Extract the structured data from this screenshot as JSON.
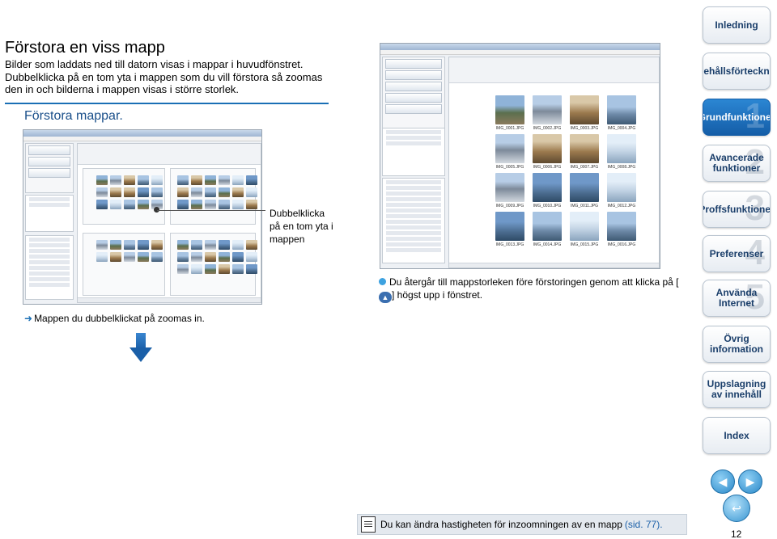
{
  "heading": {
    "title": "Förstora en viss mapp",
    "intro": "Bilder som laddats ned till datorn visas i mappar i huvudfönstret. Dubbelklicka på en tom yta i mappen som du vill förstora så zoomas den in och bilderna i mappen visas i större storlek.",
    "subhead": "Förstora mappar."
  },
  "callout": {
    "text": "Dubbelklicka på en tom yta i mappen"
  },
  "result_note": {
    "arrow": "➜",
    "text": "Mappen du dubbelklickat på zoomas in."
  },
  "tip": {
    "before": "Du återgår till mappstorleken före förstoringen genom att klicka på [",
    "after": "] högst upp i fönstret."
  },
  "screenshot_zoomed": {
    "thumbnails": [
      {
        "caption": "IMG_0001.JPG",
        "tone": "t1"
      },
      {
        "caption": "IMG_0002.JPG",
        "tone": "t2"
      },
      {
        "caption": "IMG_0003.JPG",
        "tone": "t3"
      },
      {
        "caption": "IMG_0004.JPG",
        "tone": "t4"
      },
      {
        "caption": "IMG_0005.JPG",
        "tone": "t2"
      },
      {
        "caption": "IMG_0006.JPG",
        "tone": "t3"
      },
      {
        "caption": "IMG_0007.JPG",
        "tone": "t3"
      },
      {
        "caption": "IMG_0008.JPG",
        "tone": "t5"
      },
      {
        "caption": "IMG_0009.JPG",
        "tone": "t2"
      },
      {
        "caption": "IMG_0010.JPG",
        "tone": "t6"
      },
      {
        "caption": "IMG_0011.JPG",
        "tone": "t6"
      },
      {
        "caption": "IMG_0012.JPG",
        "tone": "t5"
      },
      {
        "caption": "IMG_0013.JPG",
        "tone": "t6"
      },
      {
        "caption": "IMG_0014.JPG",
        "tone": "t4"
      },
      {
        "caption": "IMG_0015.JPG",
        "tone": "t5"
      },
      {
        "caption": "IMG_0016.JPG",
        "tone": "t4"
      }
    ]
  },
  "nav": {
    "items": [
      {
        "label": "Inledning",
        "num": "",
        "active": false
      },
      {
        "label": "Innehållsförteckning",
        "num": "",
        "active": false
      },
      {
        "label": "Grundfunktioner",
        "num": "1",
        "active": true
      },
      {
        "label": "Avancerade funktioner",
        "num": "2",
        "active": false
      },
      {
        "label": "Proffsfunktioner",
        "num": "3",
        "active": false
      },
      {
        "label": "Preferenser",
        "num": "4",
        "active": false
      },
      {
        "label": "Använda Internet",
        "num": "5",
        "active": false
      },
      {
        "label": "Övrig information",
        "num": "",
        "active": false
      },
      {
        "label": "Uppslagning av innehåll",
        "num": "",
        "active": false
      },
      {
        "label": "Index",
        "num": "",
        "active": false
      }
    ]
  },
  "footer": {
    "note": "Du kan ändra hastigheten för inzoomningen av en mapp",
    "link": "(sid. 77).",
    "page": "12"
  },
  "colors": {
    "accent": "#1a6fb5",
    "nav_active": "#155ea8",
    "tip_bullet": "#3da2e0"
  }
}
